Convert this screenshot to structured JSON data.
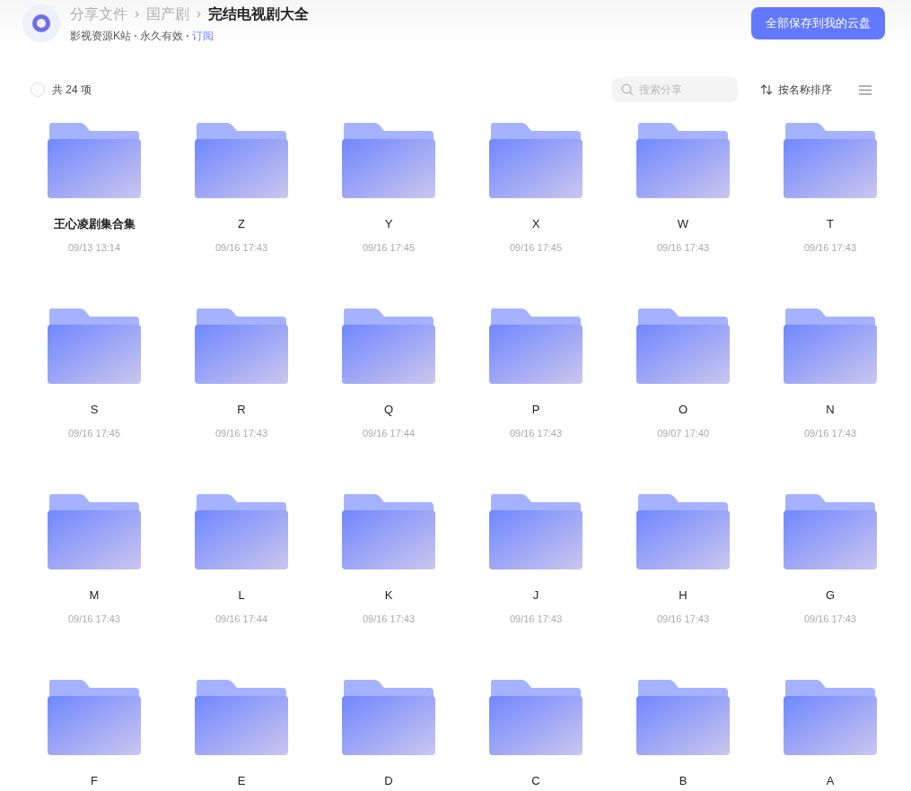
{
  "header": {
    "breadcrumbs": [
      {
        "label": "分享文件",
        "current": false
      },
      {
        "label": "国产剧",
        "current": false
      },
      {
        "label": "完结电视剧大全",
        "current": true
      }
    ],
    "subtitle": {
      "source": "影视资源K站",
      "validity": "永久有效",
      "subscribe_link": "订阅"
    },
    "save_button": "全部保存到我的云盘"
  },
  "toolbar": {
    "select_all": {
      "checked": false,
      "label": "共 24 项"
    },
    "search": {
      "placeholder": "搜索分享"
    },
    "sort": "按名称排序"
  },
  "folders": [
    {
      "name": "王心凌剧集合集",
      "date": "09/13 13:14"
    },
    {
      "name": "Z",
      "date": "09/16 17:43"
    },
    {
      "name": "Y",
      "date": "09/16 17:45"
    },
    {
      "name": "X",
      "date": "09/16 17:45"
    },
    {
      "name": "W",
      "date": "09/16 17:43"
    },
    {
      "name": "T",
      "date": "09/16 17:43"
    },
    {
      "name": "S",
      "date": "09/16 17:45"
    },
    {
      "name": "R",
      "date": "09/16 17:43"
    },
    {
      "name": "Q",
      "date": "09/16 17:44"
    },
    {
      "name": "P",
      "date": "09/16 17:43"
    },
    {
      "name": "O",
      "date": "09/07 17:40"
    },
    {
      "name": "N",
      "date": "09/16 17:43"
    },
    {
      "name": "M",
      "date": "09/16 17:43"
    },
    {
      "name": "L",
      "date": "09/16 17:44"
    },
    {
      "name": "K",
      "date": "09/16 17:43"
    },
    {
      "name": "J",
      "date": "09/16 17:43"
    },
    {
      "name": "H",
      "date": "09/16 17:43"
    },
    {
      "name": "G",
      "date": "09/16 17:43"
    },
    {
      "name": "F"
    },
    {
      "name": "E"
    },
    {
      "name": "D"
    },
    {
      "name": "C"
    },
    {
      "name": "B"
    },
    {
      "name": "A"
    }
  ]
}
